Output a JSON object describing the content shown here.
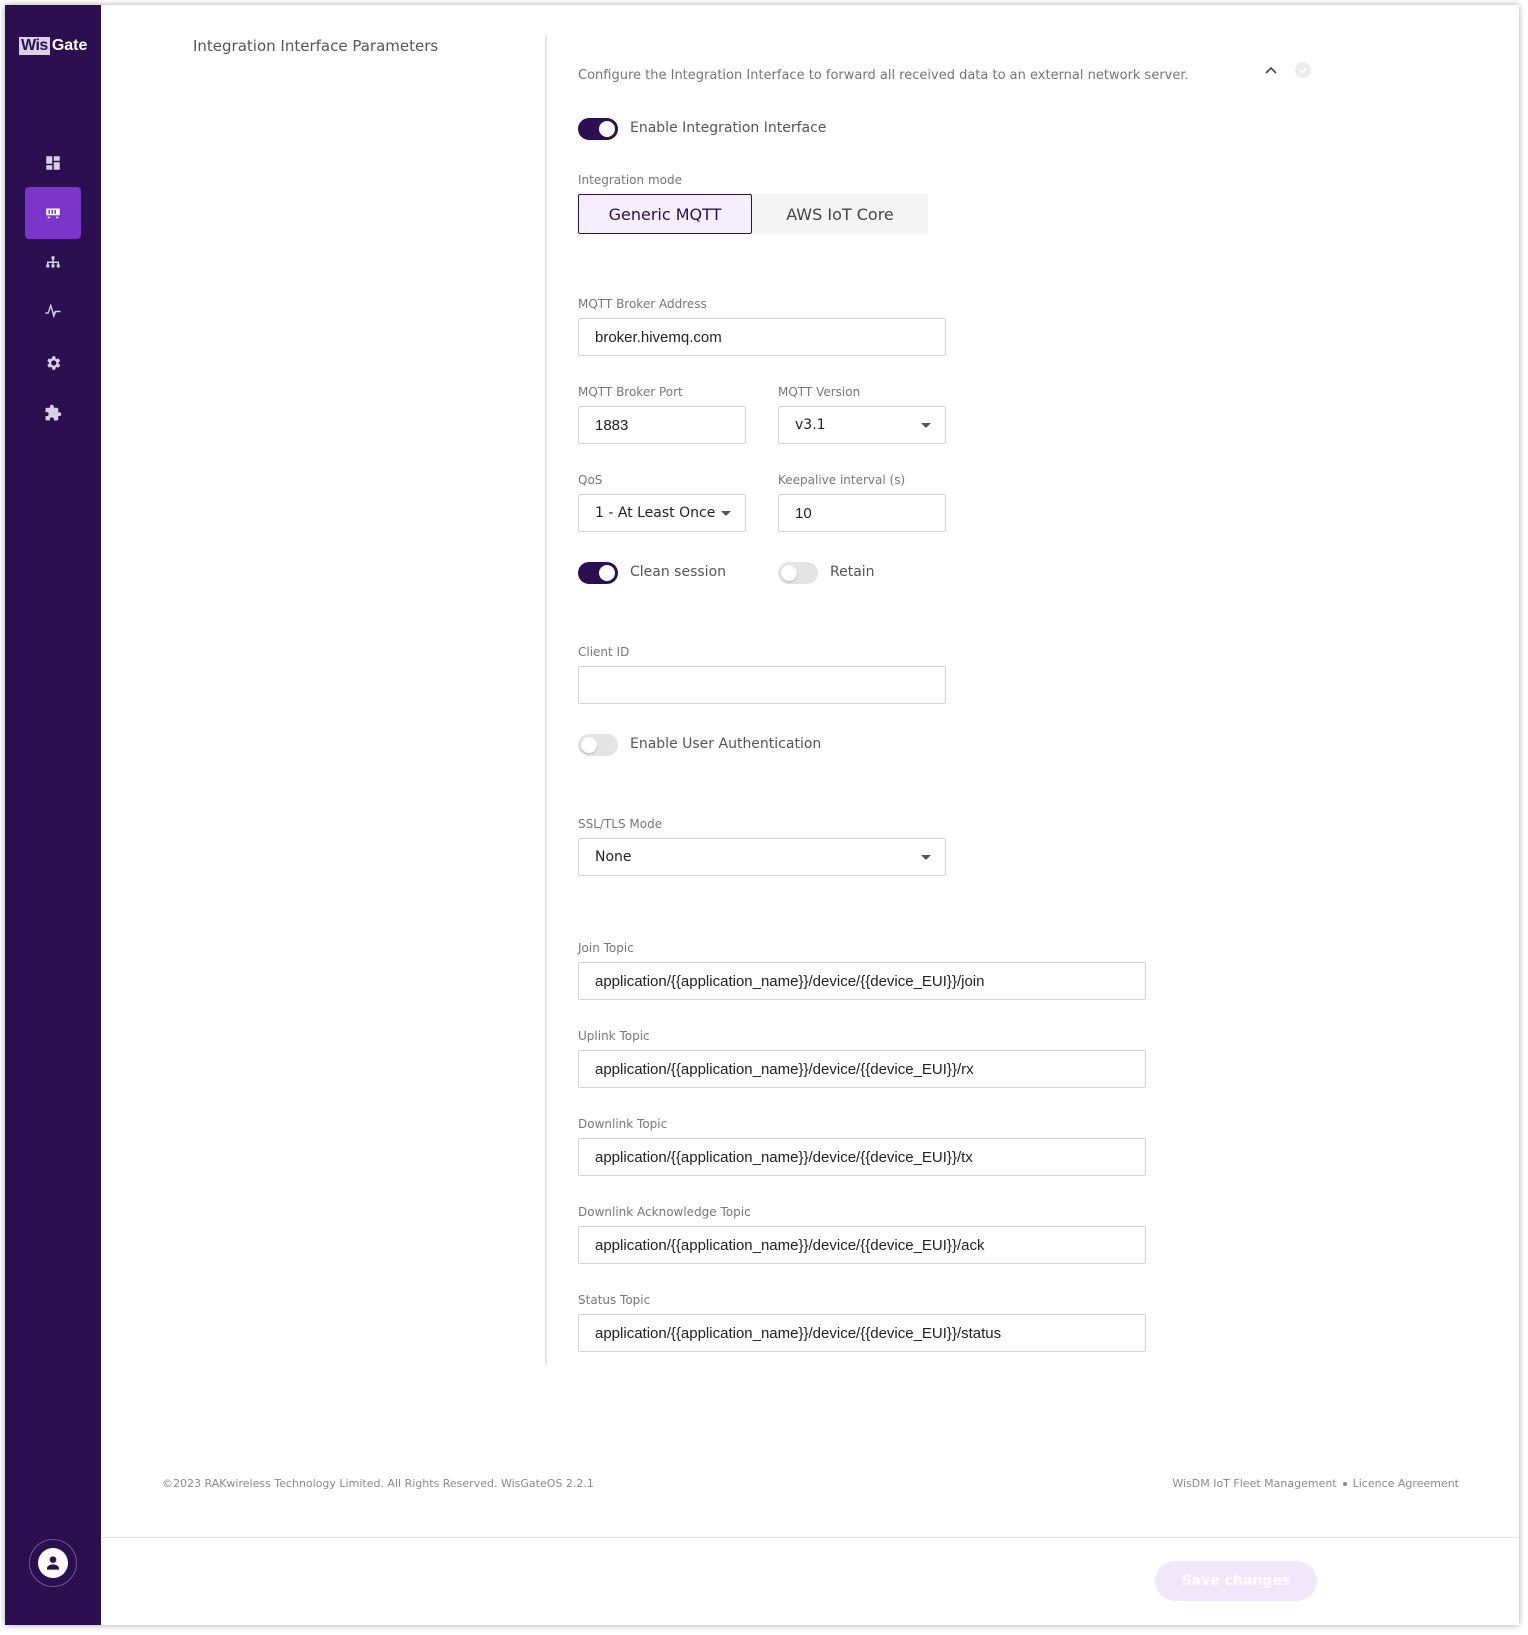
{
  "sidebar": {
    "logo_wis": "Wis",
    "logo_gate": "Gate",
    "items": [
      {
        "icon": "dashboard-icon"
      },
      {
        "icon": "gateway-icon",
        "active": true
      },
      {
        "icon": "network-icon"
      },
      {
        "icon": "activity-icon"
      },
      {
        "icon": "settings-icon"
      },
      {
        "icon": "extensions-icon"
      }
    ],
    "avatar_icon": "user-icon"
  },
  "section": {
    "title": "Integration Interface Parameters",
    "description": "Configure the Integration Interface to forward all received data to an external network server."
  },
  "form": {
    "enable_integration": {
      "label": "Enable Integration Interface",
      "on": true
    },
    "integration_mode": {
      "label": "Integration mode",
      "options": [
        "Generic MQTT",
        "AWS IoT Core"
      ],
      "selected": "Generic MQTT"
    },
    "broker_address": {
      "label": "MQTT Broker Address",
      "value": "broker.hivemq.com"
    },
    "broker_port": {
      "label": "MQTT Broker Port",
      "value": "1883"
    },
    "mqtt_version": {
      "label": "MQTT Version",
      "value": "v3.1"
    },
    "qos": {
      "label": "QoS",
      "value": "1 - At Least Once"
    },
    "keepalive": {
      "label": "Keepalive interval (s)",
      "value": "10"
    },
    "clean_session": {
      "label": "Clean session",
      "on": true
    },
    "retain": {
      "label": "Retain",
      "on": false
    },
    "client_id": {
      "label": "Client ID",
      "value": ""
    },
    "user_auth": {
      "label": "Enable User Authentication",
      "on": false
    },
    "ssl_mode": {
      "label": "SSL/TLS Mode",
      "value": "None"
    },
    "join_topic": {
      "label": "Join Topic",
      "value": "application/{{application_name}}/device/{{device_EUI}}/join"
    },
    "uplink_topic": {
      "label": "Uplink Topic",
      "value": "application/{{application_name}}/device/{{device_EUI}}/rx"
    },
    "downlink_topic": {
      "label": "Downlink Topic",
      "value": "application/{{application_name}}/device/{{device_EUI}}/tx"
    },
    "downlink_ack_topic": {
      "label": "Downlink Acknowledge Topic",
      "value": "application/{{application_name}}/device/{{device_EUI}}/ack"
    },
    "status_topic": {
      "label": "Status Topic",
      "value": "application/{{application_name}}/device/{{device_EUI}}/status"
    }
  },
  "footer": {
    "copyright": "©2023 RAKwireless Technology Limited. All Rights Reserved. WisGateOS 2.2.1",
    "link_fleet": "WisDM IoT Fleet Management",
    "link_licence": "Licence Agreement"
  },
  "actions": {
    "save_label": "Save changes"
  },
  "colors": {
    "sidebar": "#2c0f50",
    "accent": "#7c35c9",
    "toggle_on": "#2c0f50"
  }
}
